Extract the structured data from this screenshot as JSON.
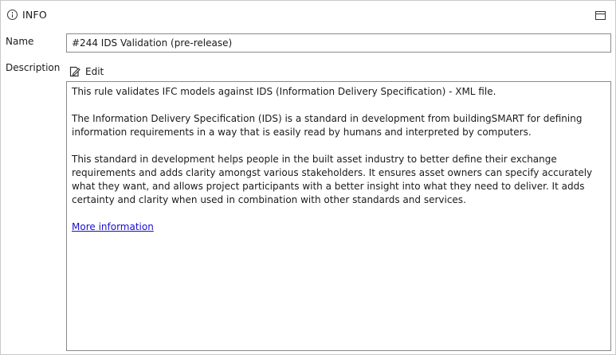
{
  "header": {
    "title": "INFO",
    "icon": "info-icon",
    "window_icon": "window-icon"
  },
  "fields": {
    "name_label": "Name",
    "name_value": "#244 IDS Validation (pre-release)",
    "description_label": "Description",
    "edit_label": "Edit"
  },
  "description": {
    "paragraphs": [
      "This rule validates IFC models against IDS (Information Delivery Specification) - XML file.",
      "The Information Delivery Specification (IDS) is a standard in development from buildingSMART for defining information requirements in a way that is easily read by humans and interpreted by computers.",
      "This standard in development helps people in the built asset industry to better define their exchange requirements and adds clarity amongst various stakeholders. It ensures asset owners can specify accurately what they want, and allows project participants with a better insight into what they need to deliver. It adds certainty and clarity when used in combination with other standards and services."
    ],
    "link_text": "More information"
  }
}
